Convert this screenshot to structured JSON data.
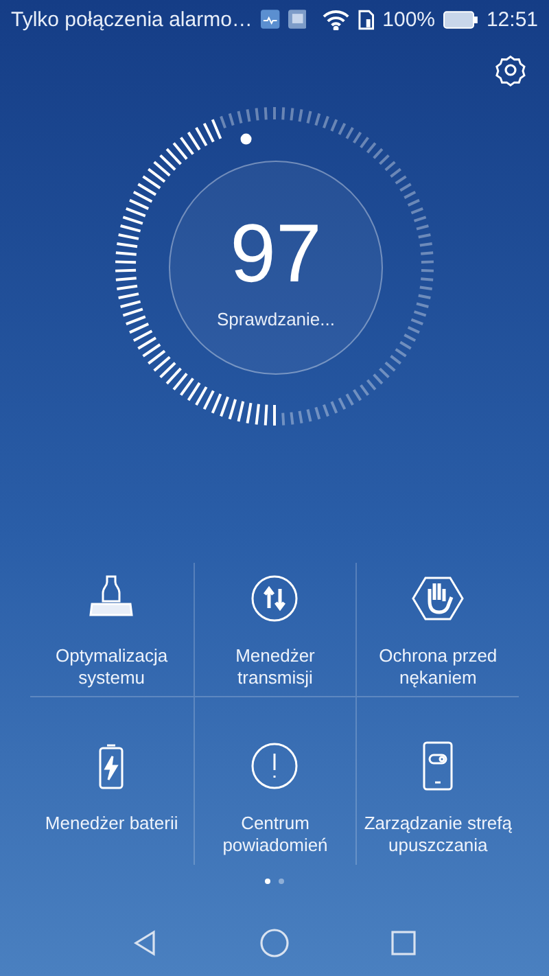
{
  "status_bar": {
    "notification_text": "Tylko połączenia alarmo…",
    "battery_percent": "100%",
    "time": "12:51"
  },
  "scan": {
    "score": "97",
    "status": "Sprawdzanie..."
  },
  "tools": [
    {
      "kind": "broom",
      "lines": [
        "Optymalizacja",
        "systemu"
      ]
    },
    {
      "kind": "transfer",
      "lines": [
        "Menedżer",
        "transmisji"
      ]
    },
    {
      "kind": "hand",
      "lines": [
        "Ochrona przed",
        "nękaniem"
      ]
    },
    {
      "kind": "battery",
      "lines": [
        "Menedżer baterii"
      ]
    },
    {
      "kind": "alert",
      "lines": [
        "Centrum",
        "powiadomień"
      ]
    },
    {
      "kind": "toggle",
      "lines": [
        "Zarządzanie strefą",
        "upuszczania"
      ]
    }
  ],
  "page_dots": [
    {
      "selected": true
    },
    {
      "selected": false
    }
  ]
}
